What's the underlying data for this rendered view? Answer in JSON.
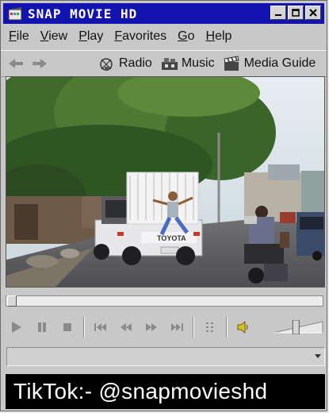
{
  "window": {
    "title": "SNAP MOVIE HD"
  },
  "menu": [
    {
      "u": "F",
      "rest": "ile"
    },
    {
      "u": "V",
      "rest": "iew"
    },
    {
      "u": "P",
      "rest": "lay"
    },
    {
      "u": "F",
      "rest": "avorites",
      "pre": ""
    },
    {
      "u": "G",
      "rest": "o"
    },
    {
      "u": "H",
      "rest": "elp"
    }
  ],
  "toolbar": {
    "radio": "Radio",
    "music": "Music",
    "media_guide": "Media Guide"
  },
  "playback": {
    "seek_fraction": 0.0,
    "volume_fraction": 0.45
  },
  "caption": {
    "text": "TikTok:- @snapmovieshd"
  },
  "colors": {
    "titlebar": "#1313b0",
    "chrome": "#c8c8c8",
    "caption_bg": "#000000"
  }
}
